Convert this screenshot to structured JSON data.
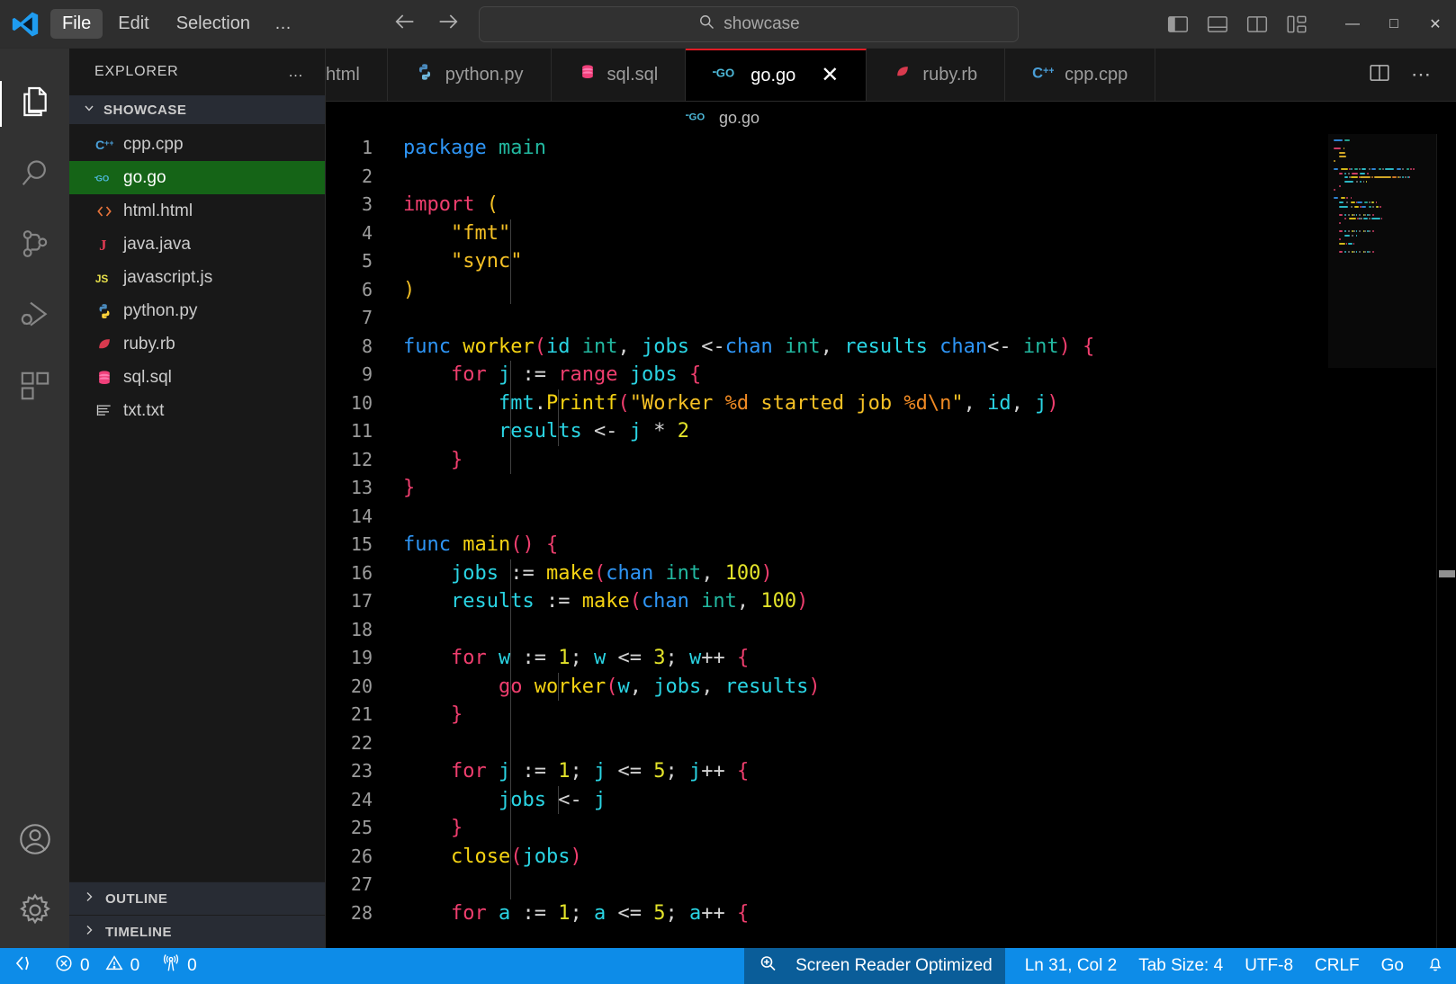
{
  "titlebar": {
    "logo_icon": "vscode-logo-icon",
    "menus": [
      {
        "label": "File",
        "active": true
      },
      {
        "label": "Edit",
        "active": false
      },
      {
        "label": "Selection",
        "active": false
      },
      {
        "label": "…",
        "active": false
      }
    ],
    "nav": {
      "back_icon": "arrow-left-icon",
      "forward_icon": "arrow-right-icon"
    },
    "search": {
      "value": "showcase",
      "placeholder": "Search",
      "icon": "search-icon"
    },
    "layout_icons": [
      {
        "name": "toggle-primary-sidebar-icon",
        "active": true
      },
      {
        "name": "toggle-panel-icon",
        "active": false
      },
      {
        "name": "toggle-secondary-sidebar-icon",
        "active": false
      },
      {
        "name": "customize-layout-icon",
        "active": false
      }
    ],
    "window_controls": [
      {
        "name": "minimize-button",
        "glyph": "—"
      },
      {
        "name": "maximize-button",
        "glyph": "□"
      },
      {
        "name": "close-button",
        "glyph": "✕"
      }
    ]
  },
  "activitybar": {
    "items": [
      {
        "name": "explorer",
        "icon": "files-icon",
        "active": true
      },
      {
        "name": "search",
        "icon": "search-icon",
        "active": false
      },
      {
        "name": "source-control",
        "icon": "source-control-icon",
        "active": false
      },
      {
        "name": "run-and-debug",
        "icon": "run-debug-icon",
        "active": false
      },
      {
        "name": "extensions",
        "icon": "extensions-icon",
        "active": false
      }
    ],
    "bottom_items": [
      {
        "name": "accounts",
        "icon": "account-icon"
      },
      {
        "name": "manage-settings",
        "icon": "gear-icon"
      }
    ]
  },
  "sidebar": {
    "title": "EXPLORER",
    "actions_icon": "ellipsis-icon",
    "folder": {
      "label": "SHOWCASE",
      "expanded": true,
      "chevron": "chevron-down-icon"
    },
    "files": [
      {
        "name": "cpp.cpp",
        "icon": "cpp-file-icon",
        "selected": false
      },
      {
        "name": "go.go",
        "icon": "go-file-icon",
        "selected": true
      },
      {
        "name": "html.html",
        "icon": "html-file-icon",
        "selected": false
      },
      {
        "name": "java.java",
        "icon": "java-file-icon",
        "selected": false
      },
      {
        "name": "javascript.js",
        "icon": "js-file-icon",
        "selected": false
      },
      {
        "name": "python.py",
        "icon": "python-file-icon",
        "selected": false
      },
      {
        "name": "ruby.rb",
        "icon": "ruby-file-icon",
        "selected": false
      },
      {
        "name": "sql.sql",
        "icon": "sql-file-icon",
        "selected": false
      },
      {
        "name": "txt.txt",
        "icon": "text-file-icon",
        "selected": false
      }
    ],
    "sections": [
      {
        "label": "OUTLINE",
        "expanded": false,
        "chevron": "chevron-right-icon"
      },
      {
        "label": "TIMELINE",
        "expanded": false,
        "chevron": "chevron-right-icon"
      }
    ]
  },
  "tabs": {
    "items": [
      {
        "label": "html",
        "icon": "html-file-icon",
        "active": false,
        "partial": true
      },
      {
        "label": "python.py",
        "icon": "python-file-icon",
        "active": false
      },
      {
        "label": "sql.sql",
        "icon": "sql-file-icon",
        "active": false
      },
      {
        "label": "go.go",
        "icon": "go-file-icon",
        "active": true,
        "close_glyph": "✕"
      },
      {
        "label": "ruby.rb",
        "icon": "ruby-file-icon",
        "active": false
      },
      {
        "label": "cpp.cpp",
        "icon": "cpp-file-icon",
        "active": false
      }
    ],
    "actions": [
      {
        "name": "split-editor-right-button",
        "icon": "split-editor-icon"
      },
      {
        "name": "more-editor-actions-button",
        "icon": "ellipsis-icon"
      }
    ]
  },
  "breadcrumb": {
    "file": "go.go",
    "icon": "go-file-icon"
  },
  "editor": {
    "language": "Go",
    "lines": [
      {
        "n": 1,
        "tokens": [
          [
            "k-kw",
            "package"
          ],
          [
            "k-plain",
            " "
          ],
          [
            "k-pk",
            "main"
          ]
        ]
      },
      {
        "n": 2,
        "tokens": []
      },
      {
        "n": 3,
        "tokens": [
          [
            "k-ctrl",
            "import"
          ],
          [
            "k-plain",
            " "
          ],
          [
            "k-str",
            "("
          ]
        ]
      },
      {
        "n": 4,
        "tokens": [
          [
            "k-plain",
            "    "
          ],
          [
            "k-str",
            "\"fmt\""
          ]
        ]
      },
      {
        "n": 5,
        "tokens": [
          [
            "k-plain",
            "    "
          ],
          [
            "k-str",
            "\"sync\""
          ]
        ]
      },
      {
        "n": 6,
        "tokens": [
          [
            "k-str",
            ")"
          ]
        ]
      },
      {
        "n": 7,
        "tokens": []
      },
      {
        "n": 8,
        "tokens": [
          [
            "k-kw",
            "func"
          ],
          [
            "k-plain",
            " "
          ],
          [
            "k-fn",
            "worker"
          ],
          [
            "k-punc",
            "("
          ],
          [
            "k-var",
            "id"
          ],
          [
            "k-plain",
            " "
          ],
          [
            "k-pk",
            "int"
          ],
          [
            "k-plain",
            ", "
          ],
          [
            "k-var",
            "jobs"
          ],
          [
            "k-plain",
            " "
          ],
          [
            "k-op",
            "<-"
          ],
          [
            "k-kw",
            "chan"
          ],
          [
            "k-plain",
            " "
          ],
          [
            "k-pk",
            "int"
          ],
          [
            "k-plain",
            ", "
          ],
          [
            "k-var",
            "results"
          ],
          [
            "k-plain",
            " "
          ],
          [
            "k-kw",
            "chan"
          ],
          [
            "k-op",
            "<-"
          ],
          [
            "k-plain",
            " "
          ],
          [
            "k-pk",
            "int"
          ],
          [
            "k-punc",
            ")"
          ],
          [
            "k-plain",
            " "
          ],
          [
            "k-punc",
            "{"
          ]
        ]
      },
      {
        "n": 9,
        "tokens": [
          [
            "k-plain",
            "    "
          ],
          [
            "k-ctrl",
            "for"
          ],
          [
            "k-plain",
            " "
          ],
          [
            "k-var",
            "j"
          ],
          [
            "k-plain",
            " "
          ],
          [
            "k-op",
            ":="
          ],
          [
            "k-plain",
            " "
          ],
          [
            "k-ctrl",
            "range"
          ],
          [
            "k-plain",
            " "
          ],
          [
            "k-var",
            "jobs"
          ],
          [
            "k-plain",
            " "
          ],
          [
            "k-punc",
            "{"
          ]
        ]
      },
      {
        "n": 10,
        "tokens": [
          [
            "k-plain",
            "        "
          ],
          [
            "k-var",
            "fmt"
          ],
          [
            "k-plain",
            "."
          ],
          [
            "k-fn",
            "Printf"
          ],
          [
            "k-punc",
            "("
          ],
          [
            "k-str",
            "\"Worker "
          ],
          [
            "k-fmt",
            "%d"
          ],
          [
            "k-str",
            " started job "
          ],
          [
            "k-fmt",
            "%d\\n"
          ],
          [
            "k-str",
            "\""
          ],
          [
            "k-plain",
            ", "
          ],
          [
            "k-var",
            "id"
          ],
          [
            "k-plain",
            ", "
          ],
          [
            "k-var",
            "j"
          ],
          [
            "k-punc",
            ")"
          ]
        ]
      },
      {
        "n": 11,
        "tokens": [
          [
            "k-plain",
            "        "
          ],
          [
            "k-var",
            "results"
          ],
          [
            "k-plain",
            " "
          ],
          [
            "k-op",
            "<-"
          ],
          [
            "k-plain",
            " "
          ],
          [
            "k-var",
            "j"
          ],
          [
            "k-plain",
            " "
          ],
          [
            "k-op",
            "*"
          ],
          [
            "k-plain",
            " "
          ],
          [
            "k-num",
            "2"
          ]
        ]
      },
      {
        "n": 12,
        "tokens": [
          [
            "k-plain",
            "    "
          ],
          [
            "k-punc",
            "}"
          ]
        ]
      },
      {
        "n": 13,
        "tokens": [
          [
            "k-punc",
            "}"
          ]
        ]
      },
      {
        "n": 14,
        "tokens": []
      },
      {
        "n": 15,
        "tokens": [
          [
            "k-kw",
            "func"
          ],
          [
            "k-plain",
            " "
          ],
          [
            "k-fn",
            "main"
          ],
          [
            "k-punc",
            "()"
          ],
          [
            "k-plain",
            " "
          ],
          [
            "k-punc",
            "{"
          ]
        ]
      },
      {
        "n": 16,
        "tokens": [
          [
            "k-plain",
            "    "
          ],
          [
            "k-var",
            "jobs"
          ],
          [
            "k-plain",
            " "
          ],
          [
            "k-op",
            ":="
          ],
          [
            "k-plain",
            " "
          ],
          [
            "k-fn",
            "make"
          ],
          [
            "k-punc",
            "("
          ],
          [
            "k-kw",
            "chan"
          ],
          [
            "k-plain",
            " "
          ],
          [
            "k-pk",
            "int"
          ],
          [
            "k-plain",
            ", "
          ],
          [
            "k-num",
            "100"
          ],
          [
            "k-punc",
            ")"
          ]
        ]
      },
      {
        "n": 17,
        "tokens": [
          [
            "k-plain",
            "    "
          ],
          [
            "k-var",
            "results"
          ],
          [
            "k-plain",
            " "
          ],
          [
            "k-op",
            ":="
          ],
          [
            "k-plain",
            " "
          ],
          [
            "k-fn",
            "make"
          ],
          [
            "k-punc",
            "("
          ],
          [
            "k-kw",
            "chan"
          ],
          [
            "k-plain",
            " "
          ],
          [
            "k-pk",
            "int"
          ],
          [
            "k-plain",
            ", "
          ],
          [
            "k-num",
            "100"
          ],
          [
            "k-punc",
            ")"
          ]
        ]
      },
      {
        "n": 18,
        "tokens": []
      },
      {
        "n": 19,
        "tokens": [
          [
            "k-plain",
            "    "
          ],
          [
            "k-ctrl",
            "for"
          ],
          [
            "k-plain",
            " "
          ],
          [
            "k-var",
            "w"
          ],
          [
            "k-plain",
            " "
          ],
          [
            "k-op",
            ":="
          ],
          [
            "k-plain",
            " "
          ],
          [
            "k-num",
            "1"
          ],
          [
            "k-plain",
            "; "
          ],
          [
            "k-var",
            "w"
          ],
          [
            "k-plain",
            " "
          ],
          [
            "k-op",
            "<="
          ],
          [
            "k-plain",
            " "
          ],
          [
            "k-num",
            "3"
          ],
          [
            "k-plain",
            "; "
          ],
          [
            "k-var",
            "w"
          ],
          [
            "k-op",
            "++"
          ],
          [
            "k-plain",
            " "
          ],
          [
            "k-punc",
            "{"
          ]
        ]
      },
      {
        "n": 20,
        "tokens": [
          [
            "k-plain",
            "        "
          ],
          [
            "k-ctrl",
            "go"
          ],
          [
            "k-plain",
            " "
          ],
          [
            "k-fn",
            "worker"
          ],
          [
            "k-punc",
            "("
          ],
          [
            "k-var",
            "w"
          ],
          [
            "k-plain",
            ", "
          ],
          [
            "k-var",
            "jobs"
          ],
          [
            "k-plain",
            ", "
          ],
          [
            "k-var",
            "results"
          ],
          [
            "k-punc",
            ")"
          ]
        ]
      },
      {
        "n": 21,
        "tokens": [
          [
            "k-plain",
            "    "
          ],
          [
            "k-punc",
            "}"
          ]
        ]
      },
      {
        "n": 22,
        "tokens": []
      },
      {
        "n": 23,
        "tokens": [
          [
            "k-plain",
            "    "
          ],
          [
            "k-ctrl",
            "for"
          ],
          [
            "k-plain",
            " "
          ],
          [
            "k-var",
            "j"
          ],
          [
            "k-plain",
            " "
          ],
          [
            "k-op",
            ":="
          ],
          [
            "k-plain",
            " "
          ],
          [
            "k-num",
            "1"
          ],
          [
            "k-plain",
            "; "
          ],
          [
            "k-var",
            "j"
          ],
          [
            "k-plain",
            " "
          ],
          [
            "k-op",
            "<="
          ],
          [
            "k-plain",
            " "
          ],
          [
            "k-num",
            "5"
          ],
          [
            "k-plain",
            "; "
          ],
          [
            "k-var",
            "j"
          ],
          [
            "k-op",
            "++"
          ],
          [
            "k-plain",
            " "
          ],
          [
            "k-punc",
            "{"
          ]
        ]
      },
      {
        "n": 24,
        "tokens": [
          [
            "k-plain",
            "        "
          ],
          [
            "k-var",
            "jobs"
          ],
          [
            "k-plain",
            " "
          ],
          [
            "k-op",
            "<-"
          ],
          [
            "k-plain",
            " "
          ],
          [
            "k-var",
            "j"
          ]
        ]
      },
      {
        "n": 25,
        "tokens": [
          [
            "k-plain",
            "    "
          ],
          [
            "k-punc",
            "}"
          ]
        ]
      },
      {
        "n": 26,
        "tokens": [
          [
            "k-plain",
            "    "
          ],
          [
            "k-fn",
            "close"
          ],
          [
            "k-punc",
            "("
          ],
          [
            "k-var",
            "jobs"
          ],
          [
            "k-punc",
            ")"
          ]
        ]
      },
      {
        "n": 27,
        "tokens": []
      },
      {
        "n": 28,
        "tokens": [
          [
            "k-plain",
            "    "
          ],
          [
            "k-ctrl",
            "for"
          ],
          [
            "k-plain",
            " "
          ],
          [
            "k-var",
            "a"
          ],
          [
            "k-plain",
            " "
          ],
          [
            "k-op",
            ":="
          ],
          [
            "k-plain",
            " "
          ],
          [
            "k-num",
            "1"
          ],
          [
            "k-plain",
            "; "
          ],
          [
            "k-var",
            "a"
          ],
          [
            "k-plain",
            " "
          ],
          [
            "k-op",
            "<="
          ],
          [
            "k-plain",
            " "
          ],
          [
            "k-num",
            "5"
          ],
          [
            "k-plain",
            "; "
          ],
          [
            "k-var",
            "a"
          ],
          [
            "k-op",
            "++"
          ],
          [
            "k-plain",
            " "
          ],
          [
            "k-punc",
            "{"
          ]
        ]
      }
    ]
  },
  "statusbar": {
    "remote_icon": "remote-window-icon",
    "problems": {
      "errors_icon": "error-icon",
      "errors": "0",
      "warnings_icon": "warning-icon",
      "warnings": "0"
    },
    "ports": {
      "icon": "radio-tower-icon",
      "count": "0"
    },
    "accessibility_icon": "screen-reader-icon",
    "accessibility_label": "Screen Reader Optimized",
    "cursor_position": "Ln 31, Col 2",
    "tab_size": "Tab Size: 4",
    "encoding": "UTF-8",
    "eol": "CRLF",
    "language": "Go",
    "bell_icon": "notifications-bell-icon"
  },
  "colors": {
    "accent_status": "#0d8ce8",
    "accent_status_dark": "#0a5d99",
    "active_tab_border": "#e01b24",
    "selected_file_bg": "#156417",
    "titlebar_bg": "#2e2e2e",
    "sidebar_bg": "#181818",
    "editor_bg": "#000000"
  }
}
